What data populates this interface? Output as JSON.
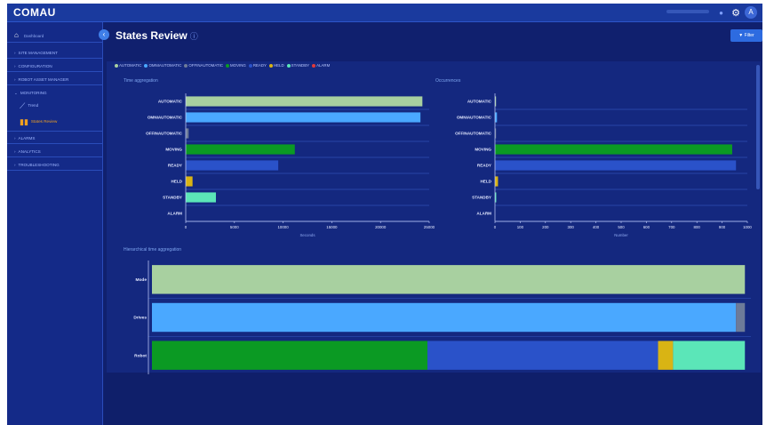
{
  "topbar": {
    "logo": "COMAU",
    "avatar": "A"
  },
  "sidebar": {
    "home": "Dashboard",
    "items": [
      {
        "label": "SITE MANAGEMENT"
      },
      {
        "label": "CONFIGURATION"
      },
      {
        "label": "ROBOT ASSET MANAGER"
      },
      {
        "label": "MONITORING"
      }
    ],
    "sub_items": [
      {
        "label": "Trend",
        "active": false
      },
      {
        "label": "States Review",
        "active": true
      }
    ],
    "items_after": [
      {
        "label": "ALARMS"
      },
      {
        "label": "ANALYTICS"
      },
      {
        "label": "TROUBLESHOOTING"
      }
    ]
  },
  "page": {
    "title": "States Review",
    "filter_label": "Filter"
  },
  "legend": [
    {
      "label": "AUTOMATIC",
      "color": "#a8d0a0"
    },
    {
      "label": "OMNIAUTOMATIC",
      "color": "#4aa8ff"
    },
    {
      "label": "OFFINAUTOMATIC",
      "color": "#6d7b99"
    },
    {
      "label": "MOVING",
      "color": "#0b9a23"
    },
    {
      "label": "READY",
      "color": "#2a52c9"
    },
    {
      "label": "HELD",
      "color": "#d9b414"
    },
    {
      "label": "STANDBY",
      "color": "#5be6b8"
    },
    {
      "label": "ALARM",
      "color": "#e03a3a"
    }
  ],
  "chart_data": [
    {
      "type": "bar",
      "title": "Time aggregation",
      "orientation": "horizontal",
      "categories": [
        "AUTOMATIC",
        "OMNIAUTOMATIC",
        "OFFINAUTOMATIC",
        "MOVING",
        "READY",
        "HELD",
        "STANDBY",
        "ALARM"
      ],
      "values": [
        24300,
        24100,
        300,
        11200,
        9500,
        700,
        3100,
        0
      ],
      "colors": [
        "#a8d0a0",
        "#4aa8ff",
        "#6d7b99",
        "#0b9a23",
        "#2a52c9",
        "#d9b414",
        "#5be6b8",
        "#e03a3a"
      ],
      "xlabel": "Seconds",
      "xlim": [
        0,
        25000
      ],
      "xticks": [
        "0",
        "5000",
        "10000",
        "15000",
        "20000",
        "25000"
      ]
    },
    {
      "type": "bar",
      "title": "Occurrences",
      "orientation": "horizontal",
      "categories": [
        "AUTOMATIC",
        "OMNIAUTOMATIC",
        "OFFINAUTOMATIC",
        "MOVING",
        "READY",
        "HELD",
        "STANDBY",
        "ALARM"
      ],
      "values": [
        4,
        8,
        2,
        940,
        955,
        12,
        5,
        0
      ],
      "colors": [
        "#a8d0a0",
        "#4aa8ff",
        "#6d7b99",
        "#0b9a23",
        "#2a52c9",
        "#d9b414",
        "#5be6b8",
        "#e03a3a"
      ],
      "xlabel": "Number",
      "xlim": [
        0,
        1000
      ],
      "xticks": [
        "0",
        "100",
        "200",
        "300",
        "400",
        "500",
        "600",
        "700",
        "800",
        "900",
        "1000"
      ]
    },
    {
      "type": "bar",
      "title": "Hierarchical time aggregation",
      "orientation": "horizontal",
      "stacked": true,
      "categories": [
        "Mode",
        "Drives",
        "Robot"
      ],
      "series": [
        {
          "values": [
            0.99,
            0,
            0
          ],
          "color": "#a8d0a0"
        },
        {
          "values": [
            0,
            0.975,
            0
          ],
          "color": "#4aa8ff"
        },
        {
          "values": [
            0,
            0.015,
            0
          ],
          "color": "#6d7b99"
        },
        {
          "values": [
            0,
            0,
            0.46
          ],
          "color": "#0b9a23"
        },
        {
          "values": [
            0,
            0,
            0.385
          ],
          "color": "#2a52c9"
        },
        {
          "values": [
            0,
            0,
            0.025
          ],
          "color": "#d9b414"
        },
        {
          "values": [
            0,
            0,
            0.12
          ],
          "color": "#5be6b8"
        }
      ]
    }
  ]
}
